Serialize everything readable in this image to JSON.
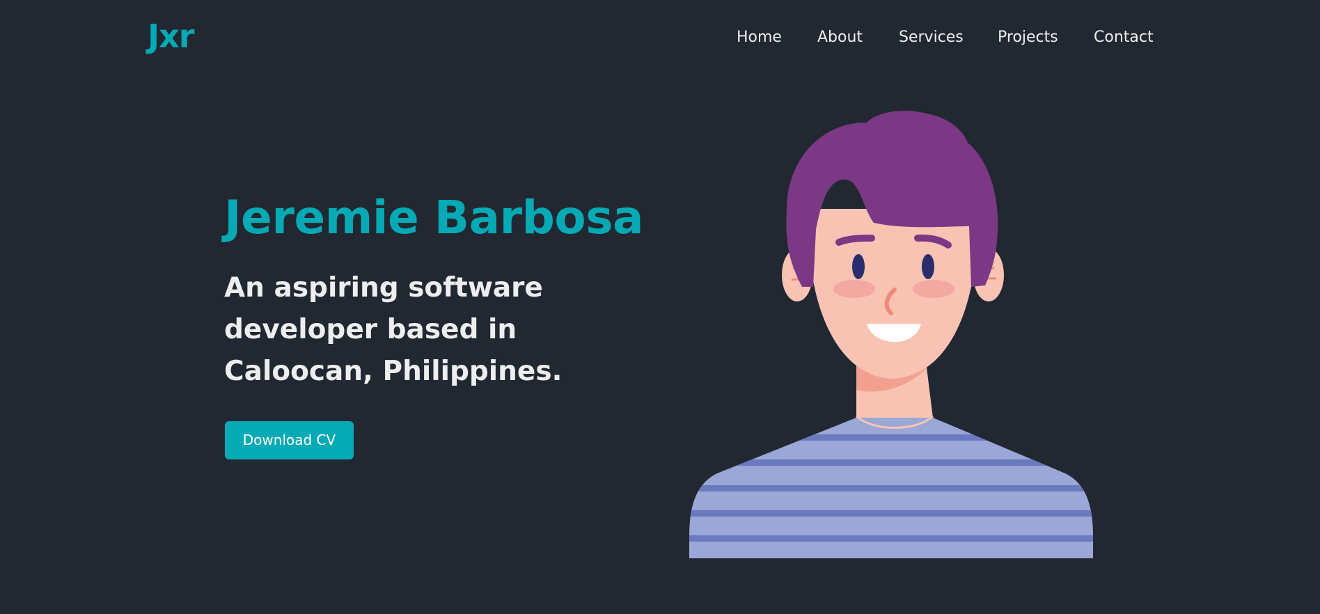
{
  "brand": {
    "logo_text": "Jxr"
  },
  "nav": {
    "items": [
      {
        "label": "Home"
      },
      {
        "label": "About"
      },
      {
        "label": "Services"
      },
      {
        "label": "Projects"
      },
      {
        "label": "Contact"
      }
    ]
  },
  "hero": {
    "name": "Jeremie Barbosa",
    "subtitle": "An aspiring software developer based in Caloocan, Philippines.",
    "cta_label": "Download CV"
  },
  "colors": {
    "background": "#222831",
    "accent": "#05aab5",
    "text": "#eeeeee",
    "hair": "#7b3884",
    "skin": "#f8c3b3",
    "shirt": "#9aa7d7",
    "shirt_stripe": "#6b79bf"
  },
  "illustration": {
    "icon": "avatar-illustration"
  }
}
